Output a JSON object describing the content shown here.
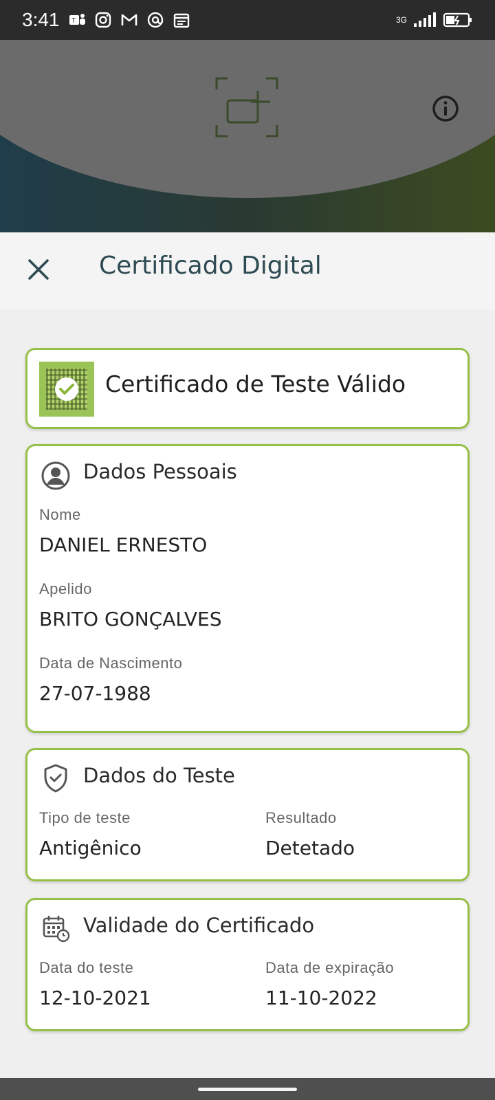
{
  "status_bar": {
    "time": "3:41",
    "left_icons": [
      "teams-icon",
      "instagram-icon",
      "gmail-icon",
      "at-icon",
      "calendar-icon"
    ],
    "network": "3G"
  },
  "header": {
    "title": "Certificado Digital"
  },
  "valid_card": {
    "title": "Certificado de Teste Válido"
  },
  "personal": {
    "title": "Dados Pessoais",
    "name_label": "Nome",
    "name_value": "DANIEL ERNESTO",
    "surname_label": "Apelido",
    "surname_value": "BRITO GONÇALVES",
    "dob_label": "Data de Nascimento",
    "dob_value": "27-07-1988"
  },
  "test": {
    "title": "Dados do Teste",
    "type_label": "Tipo de teste",
    "type_value": "Antigênico",
    "result_label": "Resultado",
    "result_value": "Detetado"
  },
  "validity": {
    "title": "Validade do Certificado",
    "test_date_label": "Data do teste",
    "test_date_value": "12-10-2021",
    "expiry_label": "Data de expiração",
    "expiry_value": "11-10-2022"
  },
  "colors": {
    "accent_green": "#97bf45",
    "title_teal": "#2e4a52",
    "status_bar": "#2b2b2b"
  }
}
